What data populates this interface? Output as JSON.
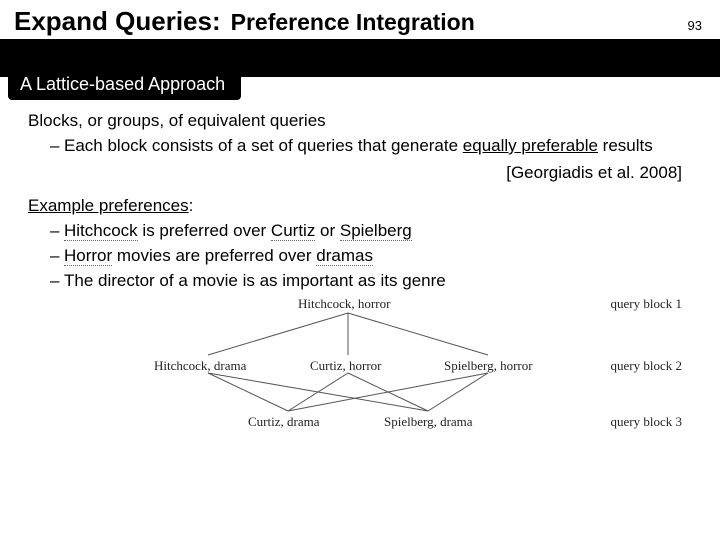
{
  "header": {
    "title_main": "Expand Queries:",
    "title_sub": "Preference Integration",
    "page_number": "93"
  },
  "section_label": "A Lattice-based Approach",
  "body": {
    "p1": "Blocks, or groups, of equivalent queries",
    "p1_sub": "Each block consists of a set of queries that generate ",
    "p1_em": "equally preferable",
    "p1_tail": " results",
    "citation": "[Georgiadis et al. 2008]",
    "p2_label": "Example preferences",
    "p2_colon": ":",
    "li1_a": "Hitchcock",
    "li1_b": " is preferred over ",
    "li1_c": "Curtiz",
    "li1_d": " or ",
    "li1_e": "Spielberg",
    "li2_a": "Horror",
    "li2_b": " movies are preferred over ",
    "li2_c": "dramas",
    "li3": "The director of a movie is as important as its genre"
  },
  "lattice": {
    "n1": "Hitchcock, horror",
    "n2a": "Hitchcock, drama",
    "n2b": "Curtiz, horror",
    "n2c": "Spielberg, horror",
    "n3a": "Curtiz, drama",
    "n3b": "Spielberg, drama",
    "q1": "query block 1",
    "q2": "query block 2",
    "q3": "query block 3"
  }
}
